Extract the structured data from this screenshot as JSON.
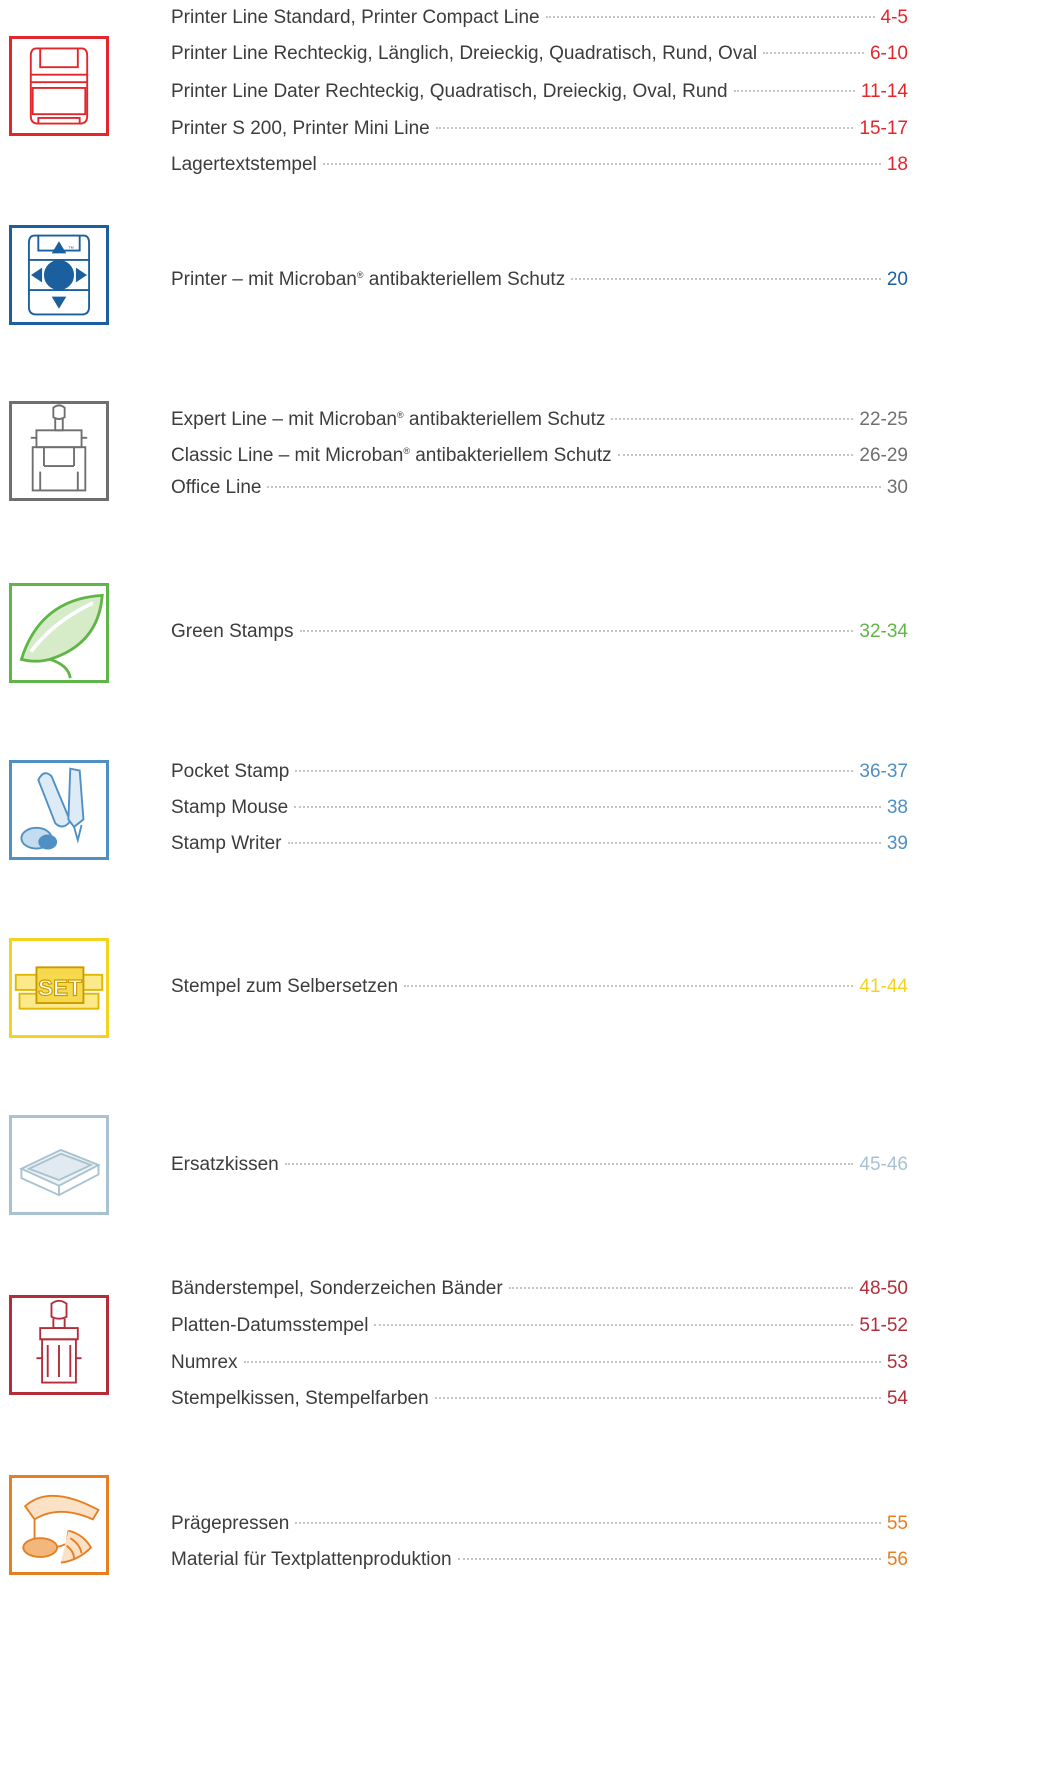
{
  "sections": [
    {
      "icon": "self-inking-stamp-icon",
      "color": "#e3262b",
      "entries": [
        {
          "label": "Printer Line Standard, Printer Compact Line",
          "page": "4-5"
        },
        {
          "label": "Printer Line Rechteckig, Länglich, Dreieckig, Quadratisch, Rund, Oval",
          "page": "6-10"
        },
        {
          "label": "Printer Line Dater Rechteckig, Quadratisch, Dreieckig, Oval, Rund",
          "page": "11-14"
        },
        {
          "label": "Printer S 200, Printer Mini Line",
          "page": "15-17"
        },
        {
          "label": "Lagertextstempel",
          "page": "18"
        }
      ]
    },
    {
      "icon": "microban-stamp-icon",
      "color": "#1b5f9e",
      "entries": [
        {
          "label_pre": "Printer – mit Microban",
          "label_sup": "®",
          "label_post": " antibakteriellem Schutz",
          "page": "20"
        }
      ]
    },
    {
      "icon": "classic-stamp-icon",
      "color": "#6f6f6f",
      "entries": [
        {
          "label_pre": "Expert Line  – mit Microban",
          "label_sup": "®",
          "label_post": " antibakteriellem Schutz",
          "page": "22-25"
        },
        {
          "label_pre": "Classic Line – mit Microban",
          "label_sup": "®",
          "label_post": " antibakteriellem Schutz",
          "page": "26-29"
        },
        {
          "label": "Office Line",
          "page": "30"
        }
      ]
    },
    {
      "icon": "leaf-icon",
      "color": "#5fb548",
      "entries": [
        {
          "label": "Green Stamps",
          "page": "32-34"
        }
      ]
    },
    {
      "icon": "pocket-stamp-icon",
      "color": "#4f8fc3",
      "entries": [
        {
          "label": "Pocket Stamp",
          "page": "36-37"
        },
        {
          "label": "Stamp Mouse",
          "page": "38"
        },
        {
          "label": "Stamp Writer",
          "page": "39"
        }
      ]
    },
    {
      "icon": "set-stamp-icon",
      "color": "#f3d320",
      "icon_text": "SET",
      "entries": [
        {
          "label": "Stempel zum Selbersetzen",
          "page": "41-44"
        }
      ]
    },
    {
      "icon": "ink-pad-icon",
      "color": "#a9c2cf",
      "entries": [
        {
          "label": "Ersatzkissen",
          "page": "45-46"
        }
      ]
    },
    {
      "icon": "band-stamp-icon",
      "color": "#b32d3a",
      "entries": [
        {
          "label": "Bänderstempel, Sonderzeichen Bänder",
          "page": "48-50"
        },
        {
          "label": "Platten-Datumsstempel",
          "page": "51-52"
        },
        {
          "label": "Numrex",
          "page": "53"
        },
        {
          "label": "Stempelkissen, Stempelfarben",
          "page": "54"
        }
      ]
    },
    {
      "icon": "embosser-icon",
      "color": "#e67e22",
      "entries": [
        {
          "label": "Prägepressen",
          "page": "55"
        },
        {
          "label": "Material für Textplattenproduktion",
          "page": "56"
        }
      ]
    }
  ]
}
